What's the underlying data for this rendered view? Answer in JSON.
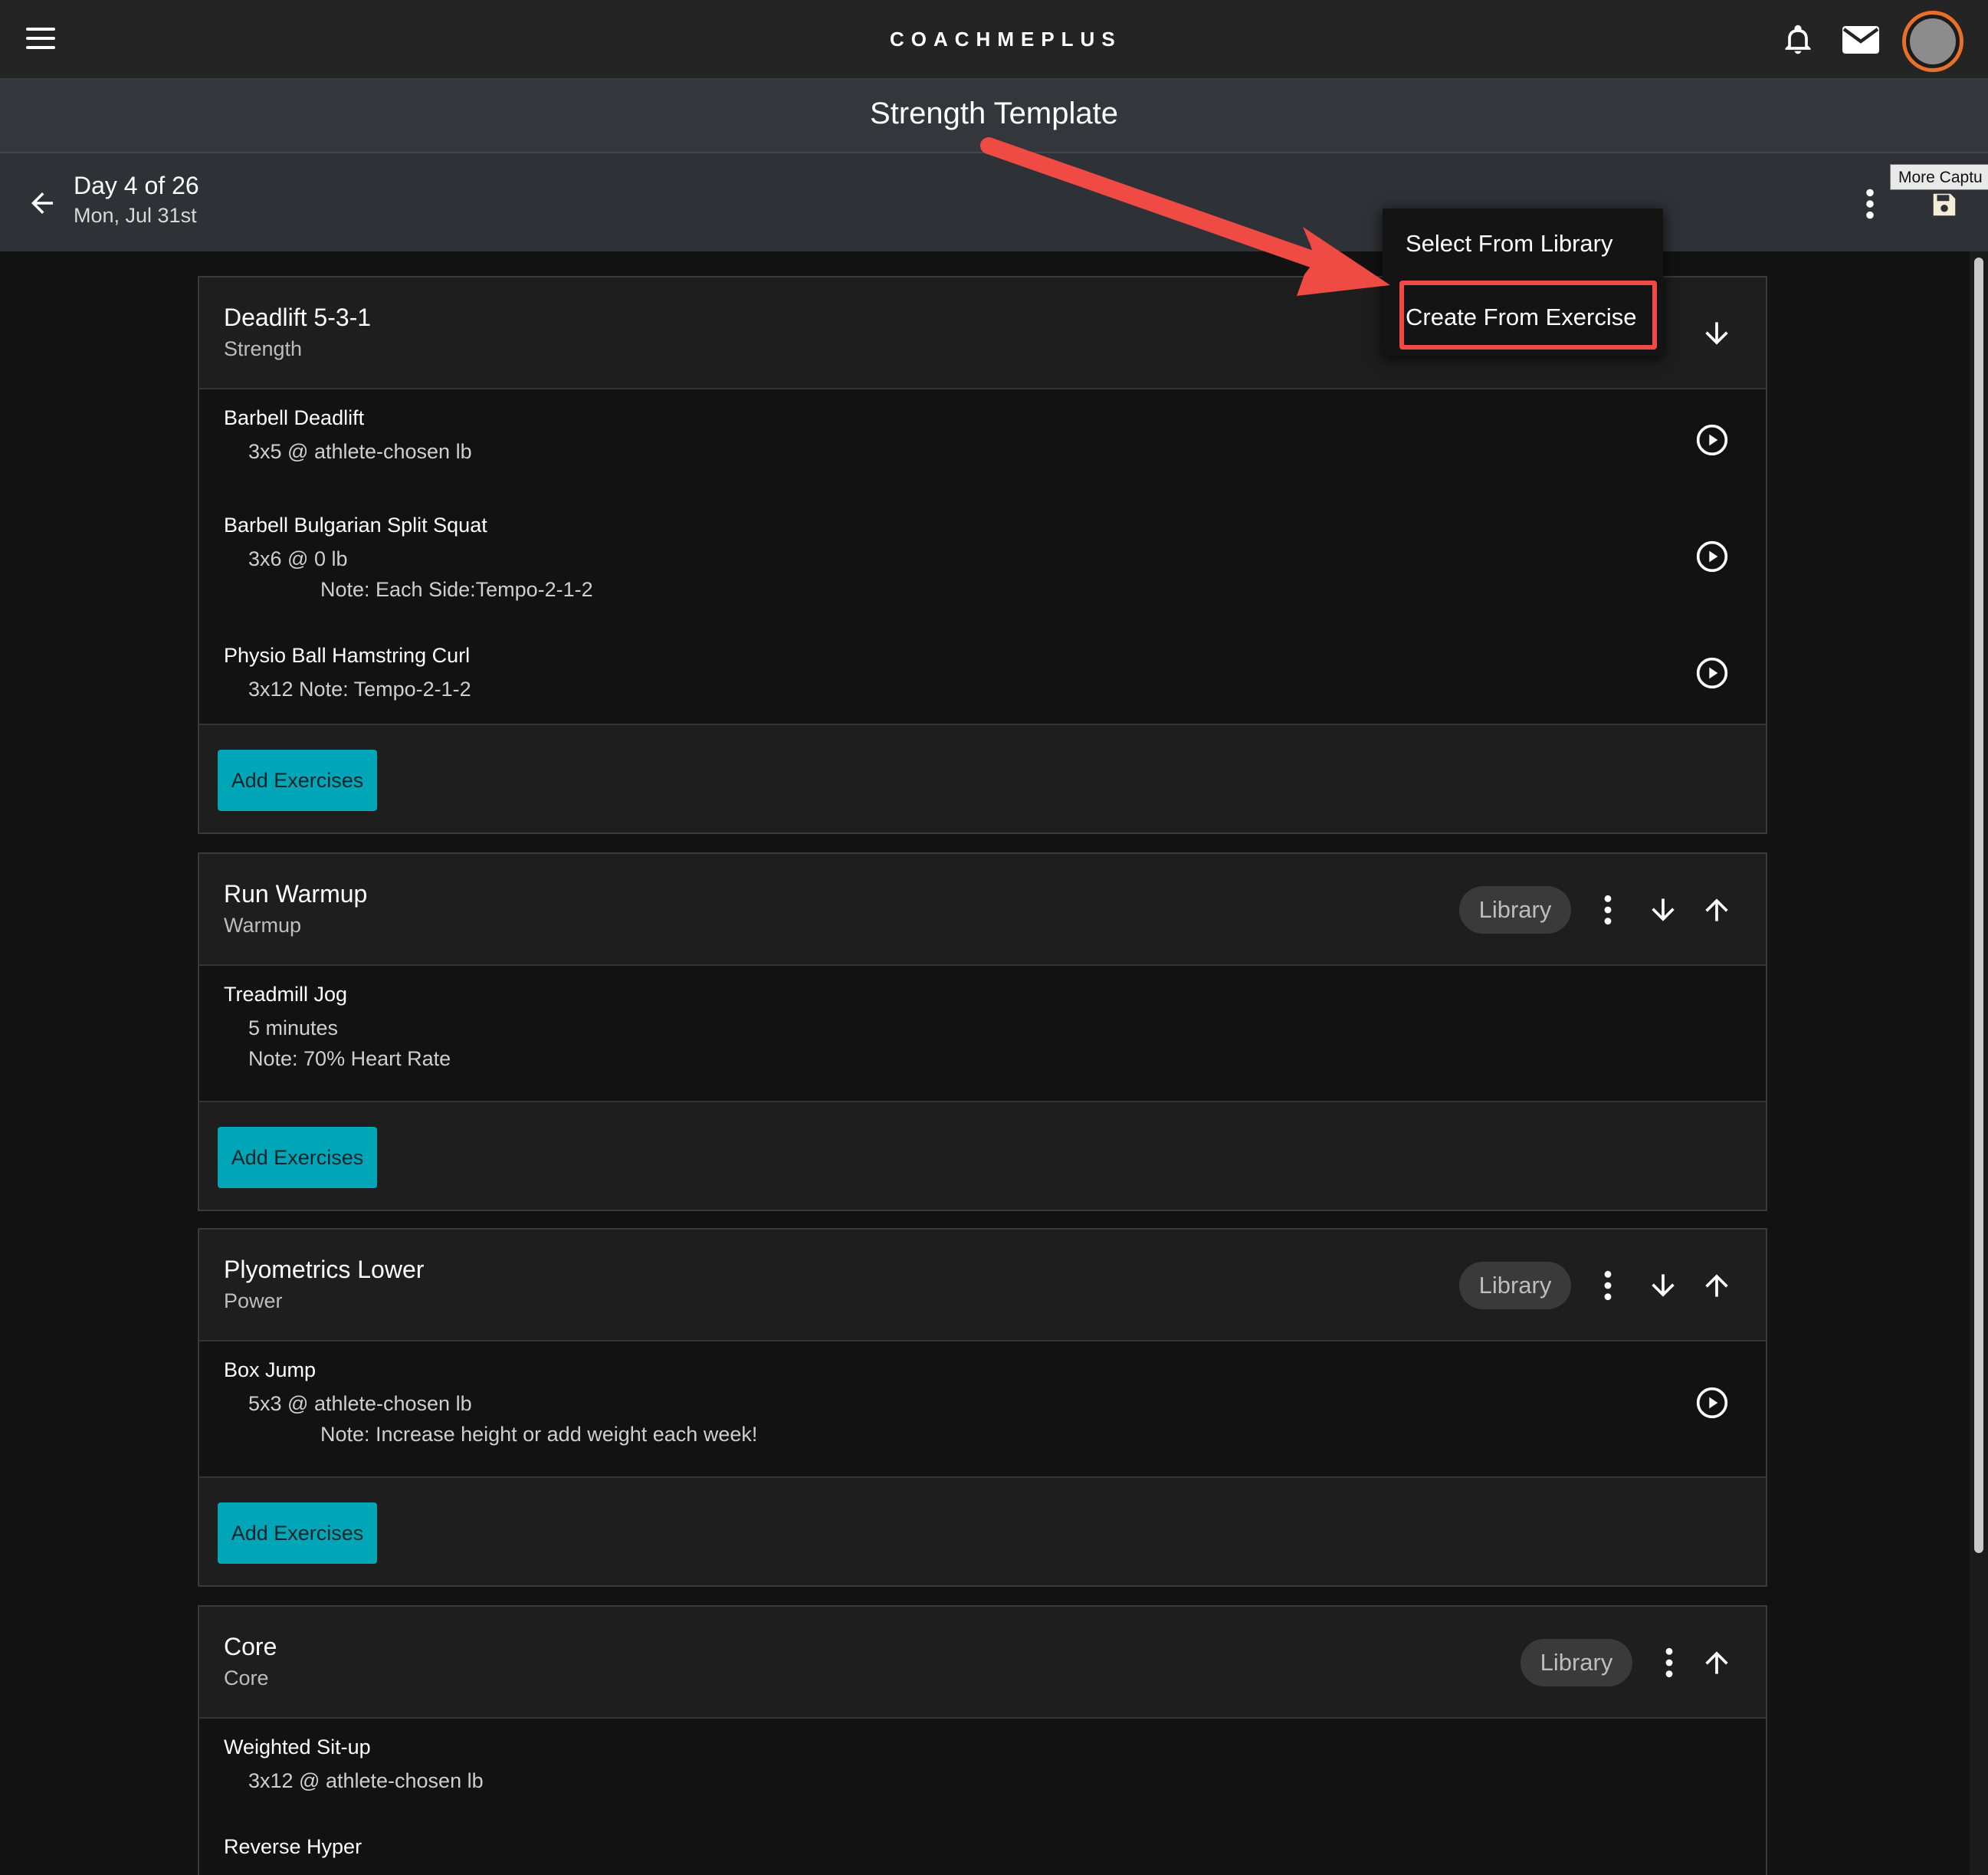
{
  "app": {
    "logo_text": "COACHMEPLUS",
    "page_title": "Strength Template",
    "brand_accent": "#00a6b7",
    "avatar_ring": "#e8702a",
    "annotation_color": "#f04a45"
  },
  "day": {
    "title": "Day 4 of 26",
    "date": "Mon, Jul 31st",
    "tooltip": "More Captu"
  },
  "dropdown": {
    "items": [
      "Select From Library",
      "Create From Exercise"
    ],
    "highlighted": "Create From Exercise"
  },
  "sections": [
    {
      "title": "Deadlift 5-3-1",
      "category": "Strength",
      "add_label": "Add Exercises",
      "exercises": [
        {
          "name": "Barbell Deadlift",
          "line1": "3x5  @ athlete-chosen lb"
        },
        {
          "name": "Barbell Bulgarian Split Squat",
          "line1": "3x6  @ 0 lb",
          "note": "Note: Each Side:Tempo-2-1-2"
        },
        {
          "name": "Physio Ball Hamstring Curl",
          "line1": "3x12  Note: Tempo-2-1-2"
        }
      ]
    },
    {
      "title": "Run Warmup",
      "category": "Warmup",
      "chip": "Library",
      "add_label": "Add Exercises",
      "exercises": [
        {
          "name": "Treadmill Jog",
          "line1": "5 minutes",
          "note": "Note: 70% Heart Rate"
        }
      ]
    },
    {
      "title": "Plyometrics Lower",
      "category": "Power",
      "chip": "Library",
      "add_label": "Add Exercises",
      "exercises": [
        {
          "name": "Box Jump",
          "line1": "5x3  @ athlete-chosen lb",
          "note": "Note: Increase height or add weight each week!"
        }
      ]
    },
    {
      "title": "Core",
      "category": "Core",
      "chip": "Library",
      "exercises": [
        {
          "name": "Weighted Sit-up",
          "line1": "3x12  @ athlete-chosen lb"
        },
        {
          "name": "Reverse Hyper"
        }
      ]
    }
  ]
}
